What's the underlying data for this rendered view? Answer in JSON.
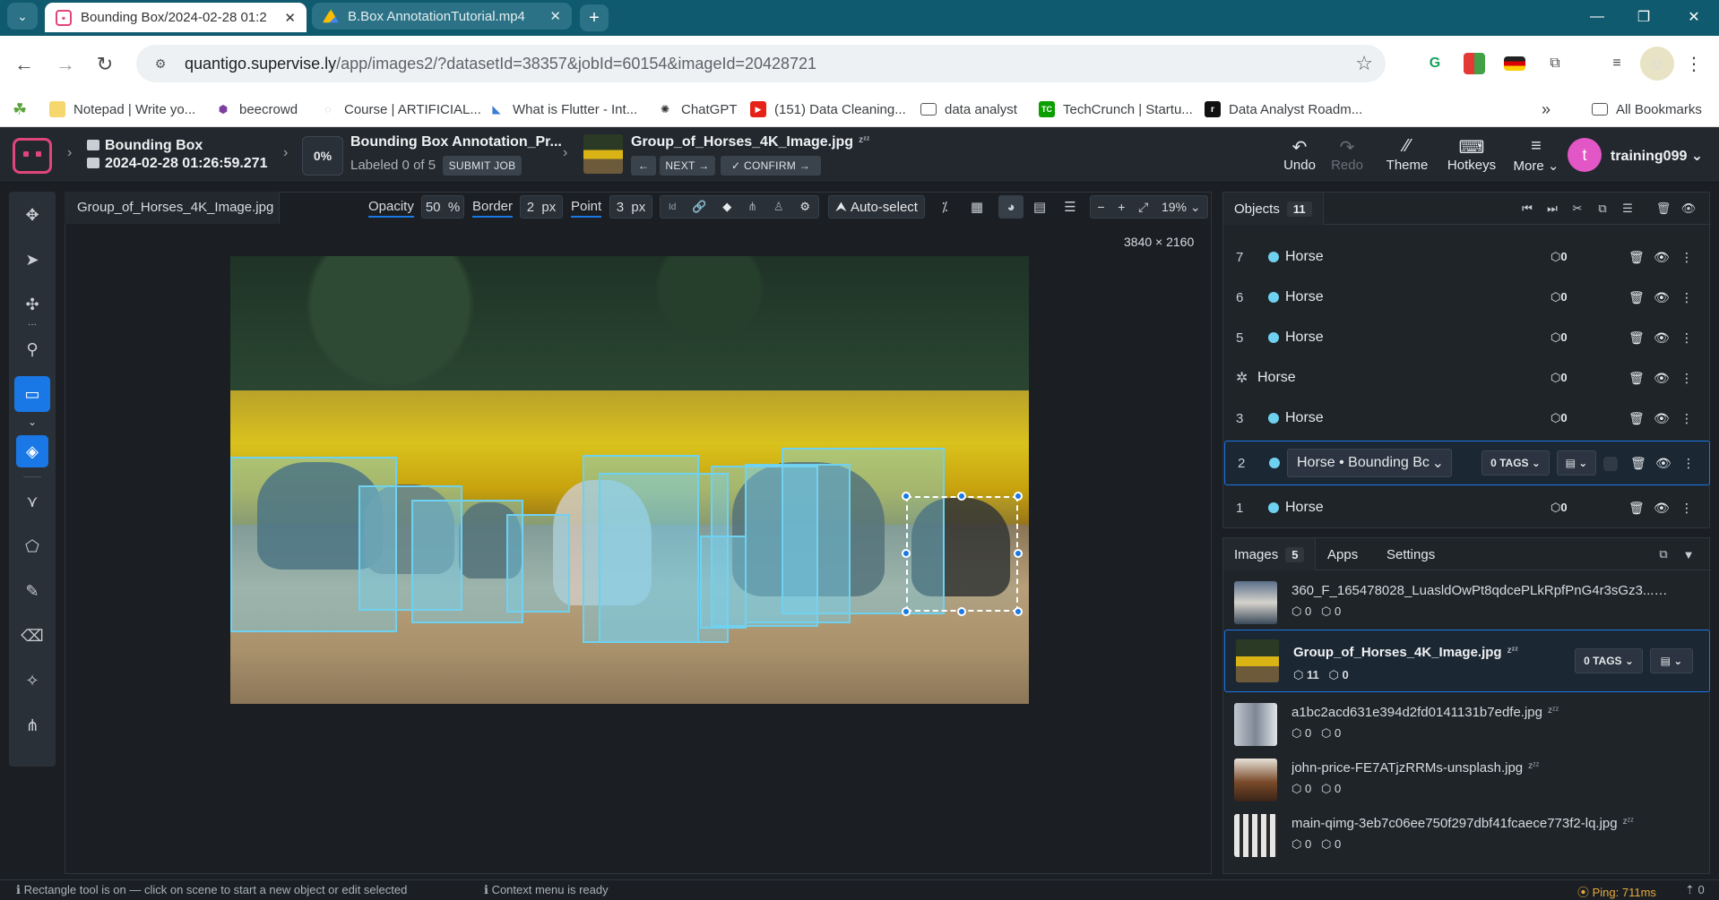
{
  "browser": {
    "tabs": [
      {
        "title": "Bounding Box/2024-02-28 01:2",
        "active": true
      },
      {
        "title": "B.Box AnnotationTutorial.mp4",
        "active": false
      }
    ],
    "url_domain": "quantigo.supervise.ly",
    "url_path": "/app/images2/?datasetId=38357&jobId=60154&imageId=20428721",
    "bookmarks": [
      {
        "label": "Notepad | Write yo...",
        "icon": "notepad-icon"
      },
      {
        "label": "beecrowd",
        "icon": "beecrowd-icon"
      },
      {
        "label": "Course | ARTIFICIAL...",
        "icon": "course-icon"
      },
      {
        "label": "What is Flutter - Int...",
        "icon": "flutter-icon"
      },
      {
        "label": "ChatGPT",
        "icon": "chatgpt-icon"
      },
      {
        "label": "(151) Data Cleaning...",
        "icon": "youtube-icon"
      },
      {
        "label": "data analyst",
        "icon": "folder-icon"
      },
      {
        "label": "TechCrunch | Startu...",
        "icon": "techcrunch-icon"
      },
      {
        "label": "Data Analyst Roadm...",
        "icon": "roadmap-icon"
      }
    ],
    "all_bookmarks": "All Bookmarks"
  },
  "header": {
    "project": "Bounding Box",
    "dataset": "2024-02-28 01:26:59.271",
    "progress": "0%",
    "job_title": "Bounding Box Annotation_Pr...",
    "labeled": "Labeled 0 of 5",
    "submit_job": "SUBMIT JOB",
    "image_title": "Group_of_Horses_4K_Image.jpg",
    "zz": "zᶻᶻ",
    "next": "NEXT",
    "confirm": "CONFIRM",
    "tools": {
      "undo": "Undo",
      "redo": "Redo",
      "theme": "Theme",
      "hotkeys": "Hotkeys",
      "more": "More"
    },
    "user_initial": "t",
    "user": "training099"
  },
  "canvas": {
    "file_tab": "Group_of_Horses_4K_Image.jpg",
    "opacity_label": "Opacity",
    "opacity": "50",
    "opacity_unit": "%",
    "border_label": "Border",
    "border": "2",
    "border_unit": "px",
    "point_label": "Point",
    "point": "3",
    "point_unit": "px",
    "auto_select": "Auto-select",
    "zoom": "19%",
    "image_size": "3840 × 2160"
  },
  "objects": {
    "tab": "Objects",
    "count": "11",
    "rows": [
      {
        "num": "7",
        "cls": "Horse",
        "tags": "0"
      },
      {
        "num": "6",
        "cls": "Horse",
        "tags": "0"
      },
      {
        "num": "5",
        "cls": "Horse",
        "tags": "0"
      },
      {
        "num": "",
        "cls": "Horse",
        "tags": "0"
      },
      {
        "num": "3",
        "cls": "Horse",
        "tags": "0"
      },
      {
        "num": "2",
        "cls": "Horse • Bounding Bc",
        "tags": "0 TAGS"
      },
      {
        "num": "1",
        "cls": "Horse",
        "tags": "0"
      }
    ]
  },
  "images_panel": {
    "tabs": [
      "Images",
      "Apps",
      "Settings"
    ],
    "count": "5",
    "items": [
      {
        "name": "360_F_165478028_LuasldOwPt8qdcePLkRpfPnG4r3sGz3...",
        "objects": "0",
        "tags": "0"
      },
      {
        "name": "Group_of_Horses_4K_Image.jpg",
        "objects": "11",
        "tags": "0",
        "tags_btn": "0 TAGS"
      },
      {
        "name": "a1bc2acd631e394d2fd0141131b7edfe.jpg",
        "objects": "0",
        "tags": "0"
      },
      {
        "name": "john-price-FE7ATjzRRMs-unsplash.jpg",
        "objects": "0",
        "tags": "0"
      },
      {
        "name": "main-qimg-3eb7c06ee750f297dbf41fcaece773f2-lq.jpg",
        "objects": "0",
        "tags": "0"
      }
    ]
  },
  "status": {
    "left": "Rectangle tool is on — click on scene to start a new object or edit selected",
    "context": "Context menu is ready",
    "ping": "Ping: 711ms"
  },
  "colors": {
    "accent": "#1a78e6",
    "bbox": "#6fd1f0",
    "brand": "#e0457b"
  }
}
